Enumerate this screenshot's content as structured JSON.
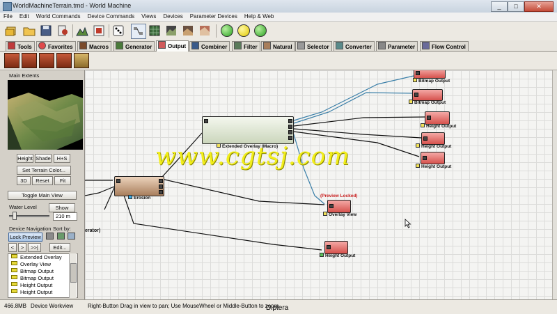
{
  "window": {
    "title": "WorldMachineTerrain.tmd - World Machine",
    "minimize": "_",
    "maximize": "□",
    "close": "✕"
  },
  "menu": [
    "File",
    "Edit",
    "World Commands",
    "Device Commands",
    "Views",
    "Devices",
    "Parameter Devices",
    "Help & Web"
  ],
  "tabs": [
    {
      "label": "Tools",
      "icon": "tools-icon"
    },
    {
      "label": "Favorites",
      "icon": "heart-icon"
    },
    {
      "label": "Macros",
      "icon": "macro-icon"
    },
    {
      "label": "Generator",
      "icon": "generator-icon"
    },
    {
      "label": "Output",
      "icon": "output-icon",
      "active": true
    },
    {
      "label": "Combiner",
      "icon": "combiner-icon"
    },
    {
      "label": "Filter",
      "icon": "filter-icon"
    },
    {
      "label": "Natural",
      "icon": "natural-icon"
    },
    {
      "label": "Selector",
      "icon": "selector-icon"
    },
    {
      "label": "Converter",
      "icon": "converter-icon"
    },
    {
      "label": "Parameter",
      "icon": "parameter-icon"
    },
    {
      "label": "Flow Control",
      "icon": "flow-control-icon"
    }
  ],
  "side": {
    "main_extents": "Main Extents",
    "view_buttons": [
      "Height",
      "Shade",
      "H+S"
    ],
    "set_terrain_color": "Set Terrain Color...",
    "mode_buttons": [
      "3D",
      "Reset",
      "Fit"
    ],
    "toggle_main_view": "Toggle Main View",
    "water_level_label": "Water Level",
    "show_button": "Show",
    "water_level_value": "210 m",
    "device_navigation": "Device Navigation",
    "sort_by": "Sort by:",
    "lock_preview": "Lock Preview",
    "nav_prev": "<",
    "nav_next": ">",
    "nav_last": ">>|",
    "edit_button": "Edit...",
    "nav_list": [
      "Extended Overlay",
      "Overlay View",
      "Bitmap Output",
      "Bitmap Output",
      "Height Output",
      "Height Output"
    ]
  },
  "canvas": {
    "partial_label": "erator)",
    "nodes": {
      "bitmap_output_1": "Bitmap Output",
      "bitmap_output_2": "Bitmap Output",
      "height_output_1": "Height Output",
      "height_output_2": "Height Output",
      "height_output_3": "Height Output",
      "extended_overlay": "Extended Overlay (Macro)",
      "erosion": "Erosion",
      "overlay_view": "Overlay View",
      "preview_locked": "(Preview Locked)",
      "height_output_4": "Height Output"
    },
    "watermark": "www.cgtsj.com"
  },
  "status": {
    "memory": "466.8MB",
    "mode": "Device Workview",
    "hint": "Right-Button Drag in view to pan; Use MouseWheel or Middle-Button to zoom",
    "caption": "Diptera"
  },
  "colors": {
    "output_node": "#d6524d",
    "macro_node": "#cbd6bc",
    "natural_node": "#a87e5c",
    "preview_locked": "#cc2222",
    "wire_blue": "#3a7fa8"
  }
}
